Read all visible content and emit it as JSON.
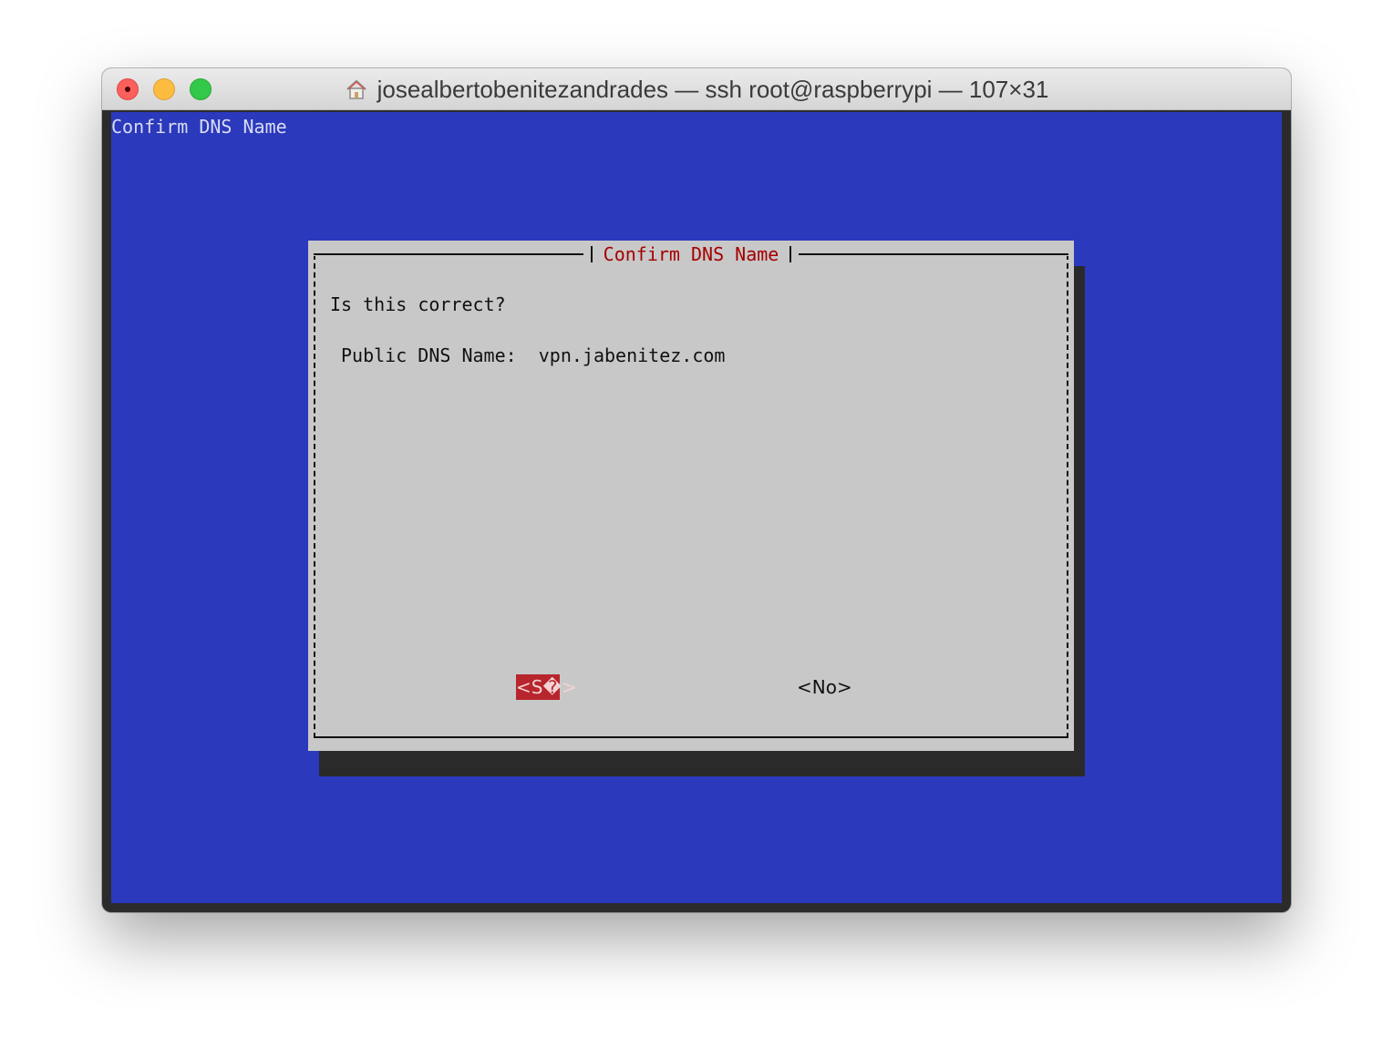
{
  "window": {
    "title": "josealbertobenitezandrades — ssh root@raspberrypi — 107×31",
    "title_icon": "home-icon",
    "colors": {
      "terminal_bg": "#2b39bd",
      "dialog_bg": "#c8c8c8",
      "dialog_title": "#a40000",
      "button_selected_bg": "#b7262d"
    }
  },
  "terminal": {
    "backtitle": "Confirm DNS Name"
  },
  "dialog": {
    "title": "Confirm DNS Name",
    "prompt": "Is this correct?",
    "dns_line": "Public DNS Name:  vpn.jabenitez.com",
    "buttons": {
      "yes_label": "<S�>",
      "no_label": "<No>"
    }
  }
}
